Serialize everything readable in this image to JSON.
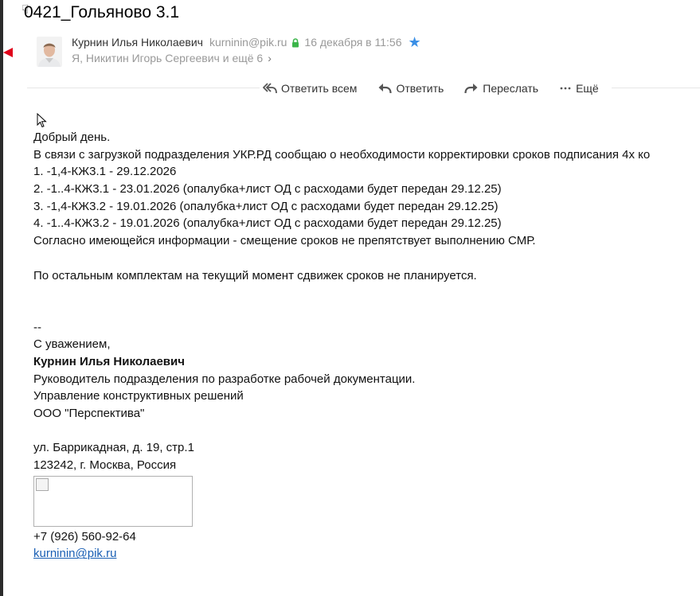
{
  "subject": "0421_Гольяново 3.1",
  "sender": {
    "name": "Курнин Илья Николаевич",
    "email": "kurninin@pik.ru",
    "date": "16 декабря в 11:56",
    "recipients": "Я, Никитин Игорь Сергеевич и ещё 6"
  },
  "toolbar": {
    "reply_all": "Ответить всем",
    "reply": "Ответить",
    "forward": "Переслать",
    "more": "Ещё"
  },
  "body": {
    "greeting": "Добрый день.",
    "intro": "В связи с загрузкой подразделения УКР.РД сообщаю о необходимости корректировки сроков подписания 4х ко",
    "items": [
      "1. -1,4-КЖ3.1 - 29.12.2026",
      "2. -1..4-КЖ3.1 - 23.01.2026 (опалубка+лист ОД с расходами будет передан 29.12.25)",
      "3. -1,4-КЖ3.2 - 19.01.2026 (опалубка+лист ОД с расходами будет передан 29.12.25)",
      "4. -1..4-КЖ3.2 - 19.01.2026 (опалубка+лист ОД с расходами будет передан 29.12.25)"
    ],
    "note": "Согласно имеющейся информации - смещение сроков не препятствует выполнению СМР.",
    "other": "По остальным комплектам на текущий момент сдвижек сроков не планируется."
  },
  "signature": {
    "separator": "--",
    "regards": "С уважением,",
    "name": "Курнин Илья Николаевич",
    "position": "Руководитель подразделения по разработке рабочей документации.",
    "department": "Управление конструктивных решений",
    "company": "ООО \"Перспектива\"",
    "address1": "ул. Баррикадная, д. 19, стр.1",
    "address2": "123242, г. Москва, Россия",
    "phone": "+7 (926) 560-92-64",
    "email": "kurninin@pik.ru"
  },
  "colors": {
    "star": "#3a8fe6",
    "lock": "#3bb54a",
    "flag": "#e0001a",
    "link": "#1a5fb4"
  },
  "icons": [
    "hand-cursor-icon",
    "lock-icon",
    "star-icon",
    "chevron-right-icon",
    "reply-all-icon",
    "reply-icon",
    "forward-icon",
    "more-icon",
    "mouse-pointer-icon",
    "broken-image-icon"
  ]
}
